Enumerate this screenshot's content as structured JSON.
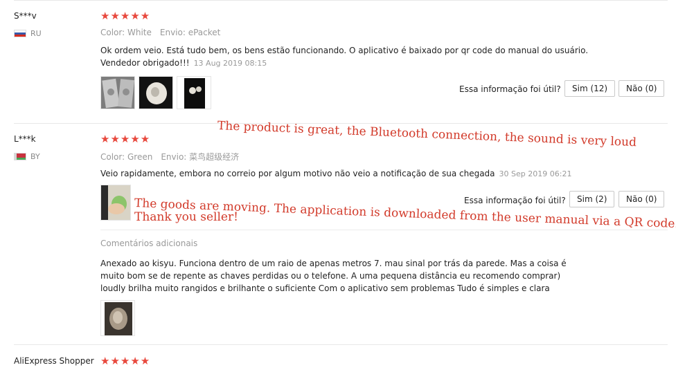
{
  "reviews": [
    {
      "user": "S***v",
      "country": "RU",
      "rating": "★★★★★",
      "color": "Color: White",
      "shipping": "Envio: ePacket",
      "text_line1": "Ok ordem veio. Está tudo bem, os bens estão funcionando. O aplicativo é baixado por qr code do manual do usuário.",
      "text_line2": "Vendedor obrigado!!!",
      "date": "13 Aug 2019 08:15",
      "helpful_label": "Essa informação foi útil?",
      "yes_label": "Sim (12)",
      "no_label": "Não (0)"
    },
    {
      "user": "L***k",
      "country": "BY",
      "rating": "★★★★★",
      "color": "Color: Green",
      "shipping": "Envio: 菜鸟超级经济",
      "text": "Veio rapidamente, embora no correio por algum motivo não veio a notificação de sua chegada",
      "date": "30 Sep 2019 06:21",
      "helpful_label": "Essa informação foi útil?",
      "yes_label": "Sim (2)",
      "no_label": "Não (0)",
      "additional_label": "Comentários adicionais",
      "additional_line1": "Anexado ao kisyu. Funciona dentro de um raio de apenas metros 7. mau sinal por trás da parede. Mas a coisa é",
      "additional_line2": "muito bom se de repente as chaves perdidas ou o telefone. A uma pequena distância eu recomendo comprar)",
      "additional_line3": "loudly brilha muito rangidos e brilhante o suficiente Com o aplicativo sem problemas Tudo é simples e clara"
    },
    {
      "user": "AliExpress Shopper",
      "rating": "★★★★★"
    }
  ],
  "annotations": {
    "line1": "The product is great, the Bluetooth connection, the sound is very loud",
    "line2": "The goods are moving. The application is downloaded from the user manual via a QR code.",
    "line3": "Thank you seller!"
  },
  "colors": {
    "star": "#e8483d",
    "annotation": "#d23a2a"
  }
}
